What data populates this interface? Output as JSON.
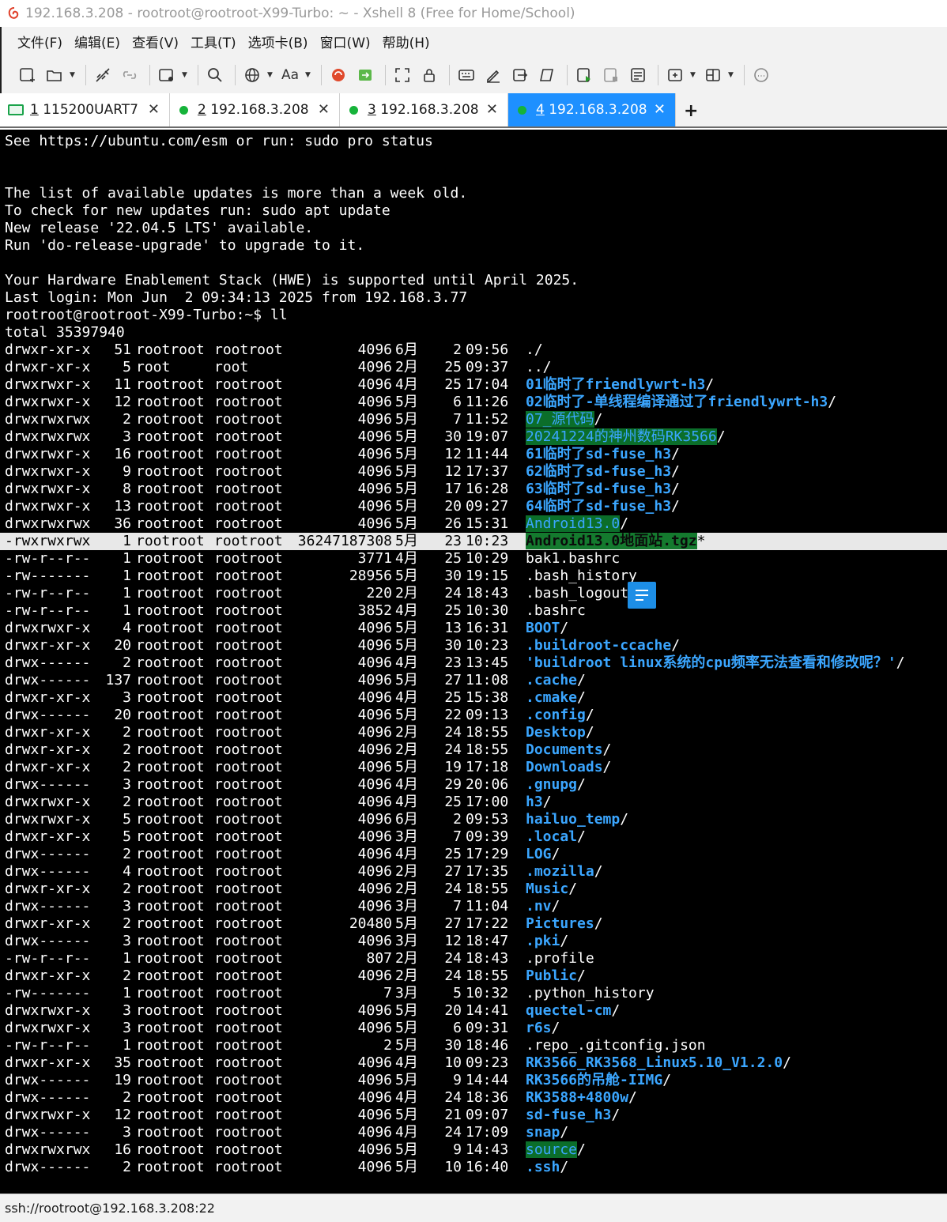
{
  "window": {
    "title": "192.168.3.208 - rootroot@rootroot-X99-Turbo: ~ - Xshell 8 (Free for Home/School)"
  },
  "menu": [
    "文件(F)",
    "编辑(E)",
    "查看(V)",
    "工具(T)",
    "选项卡(B)",
    "窗口(W)",
    "帮助(H)"
  ],
  "toolbar": {
    "font_label": "Aa"
  },
  "tabs": [
    {
      "num": "1",
      "label": " 115200UART7",
      "status": "serial",
      "active": false
    },
    {
      "num": "2",
      "label": " 192.168.3.208",
      "status": "connected",
      "active": false
    },
    {
      "num": "3",
      "label": " 192.168.3.208",
      "status": "connected",
      "active": false
    },
    {
      "num": "4",
      "label": " 192.168.3.208",
      "status": "connected",
      "active": true
    }
  ],
  "new_tab_label": "+",
  "terminal": {
    "header_lines": [
      "See https://ubuntu.com/esm or run: sudo pro status",
      "",
      "",
      "The list of available updates is more than a week old.",
      "To check for new updates run: sudo apt update",
      "New release '22.04.5 LTS' available.",
      "Run 'do-release-upgrade' to upgrade to it.",
      "",
      "Your Hardware Enablement Stack (HWE) is supported until April 2025.",
      "Last login: Mon Jun  2 09:34:13 2025 from 192.168.3.77",
      "rootroot@rootroot-X99-Turbo:~$ ll",
      "total 35397940"
    ],
    "entries": [
      {
        "perm": "drwxr-xr-x",
        "links": "51",
        "owner": "rootroot",
        "group": "rootroot",
        "size": "4096",
        "month": "6月",
        "day": "2",
        "time": "09:56",
        "name": "./",
        "style": "plain",
        "suffix": ""
      },
      {
        "perm": "drwxr-xr-x",
        "links": "5",
        "owner": "root",
        "group": "root",
        "size": "4096",
        "month": "2月",
        "day": "25",
        "time": "09:37",
        "name": "../",
        "style": "plain",
        "suffix": ""
      },
      {
        "perm": "drwxrwxr-x",
        "links": "11",
        "owner": "rootroot",
        "group": "rootroot",
        "size": "4096",
        "month": "4月",
        "day": "25",
        "time": "17:04",
        "name": "01临时了friendlywrt-h3",
        "style": "dir",
        "suffix": "/"
      },
      {
        "perm": "drwxrwxr-x",
        "links": "12",
        "owner": "rootroot",
        "group": "rootroot",
        "size": "4096",
        "month": "5月",
        "day": "6",
        "time": "11:26",
        "name": "02临时了-单线程编译通过了friendlywrt-h3",
        "style": "dir",
        "suffix": "/"
      },
      {
        "perm": "drwxrwxrwx",
        "links": "2",
        "owner": "rootroot",
        "group": "rootroot",
        "size": "4096",
        "month": "5月",
        "day": "7",
        "time": "11:52",
        "name": "07_源代码",
        "style": "hl",
        "suffix": "/"
      },
      {
        "perm": "drwxrwxrwx",
        "links": "3",
        "owner": "rootroot",
        "group": "rootroot",
        "size": "4096",
        "month": "5月",
        "day": "30",
        "time": "19:07",
        "name": "20241224的神州数码RK3566",
        "style": "hl",
        "suffix": "/"
      },
      {
        "perm": "drwxrwxr-x",
        "links": "16",
        "owner": "rootroot",
        "group": "rootroot",
        "size": "4096",
        "month": "5月",
        "day": "12",
        "time": "11:44",
        "name": "61临时了sd-fuse_h3",
        "style": "dir",
        "suffix": "/"
      },
      {
        "perm": "drwxrwxr-x",
        "links": "9",
        "owner": "rootroot",
        "group": "rootroot",
        "size": "4096",
        "month": "5月",
        "day": "12",
        "time": "17:37",
        "name": "62临时了sd-fuse_h3",
        "style": "dir",
        "suffix": "/"
      },
      {
        "perm": "drwxrwxr-x",
        "links": "8",
        "owner": "rootroot",
        "group": "rootroot",
        "size": "4096",
        "month": "5月",
        "day": "17",
        "time": "16:28",
        "name": "63临时了sd-fuse_h3",
        "style": "dir",
        "suffix": "/"
      },
      {
        "perm": "drwxrwxr-x",
        "links": "13",
        "owner": "rootroot",
        "group": "rootroot",
        "size": "4096",
        "month": "5月",
        "day": "20",
        "time": "09:27",
        "name": "64临时了sd-fuse_h3",
        "style": "dir",
        "suffix": "/"
      },
      {
        "perm": "drwxrwxrwx",
        "links": "36",
        "owner": "rootroot",
        "group": "rootroot",
        "size": "4096",
        "month": "5月",
        "day": "26",
        "time": "15:31",
        "name": "Android13.0",
        "style": "hl",
        "suffix": "/"
      },
      {
        "perm": "-rwxrwxrwx",
        "links": "1",
        "owner": "rootroot",
        "group": "rootroot",
        "size": "36247187308",
        "month": "5月",
        "day": "23",
        "time": "10:23",
        "name": "Android13.0地面站.tgz",
        "style": "exec",
        "suffix": "*"
      },
      {
        "perm": "-rw-r--r--",
        "links": "1",
        "owner": "rootroot",
        "group": "rootroot",
        "size": "3771",
        "month": "4月",
        "day": "25",
        "time": "10:29",
        "name": "bak1.bashrc",
        "style": "plain",
        "suffix": ""
      },
      {
        "perm": "-rw-------",
        "links": "1",
        "owner": "rootroot",
        "group": "rootroot",
        "size": "28956",
        "month": "5月",
        "day": "30",
        "time": "19:15",
        "name": ".bash_history",
        "style": "plain",
        "suffix": ""
      },
      {
        "perm": "-rw-r--r--",
        "links": "1",
        "owner": "rootroot",
        "group": "rootroot",
        "size": "220",
        "month": "2月",
        "day": "24",
        "time": "18:43",
        "name": ".bash_logout",
        "style": "plain",
        "suffix": ""
      },
      {
        "perm": "-rw-r--r--",
        "links": "1",
        "owner": "rootroot",
        "group": "rootroot",
        "size": "3852",
        "month": "4月",
        "day": "25",
        "time": "10:30",
        "name": ".bashrc",
        "style": "plain",
        "suffix": ""
      },
      {
        "perm": "drwxrwxr-x",
        "links": "4",
        "owner": "rootroot",
        "group": "rootroot",
        "size": "4096",
        "month": "5月",
        "day": "13",
        "time": "16:31",
        "name": "BOOT",
        "style": "dir",
        "suffix": "/"
      },
      {
        "perm": "drwxr-xr-x",
        "links": "20",
        "owner": "rootroot",
        "group": "rootroot",
        "size": "4096",
        "month": "5月",
        "day": "30",
        "time": "10:23",
        "name": ".buildroot-ccache",
        "style": "dir",
        "suffix": "/"
      },
      {
        "perm": "drwx------",
        "links": "2",
        "owner": "rootroot",
        "group": "rootroot",
        "size": "4096",
        "month": "4月",
        "day": "23",
        "time": "13:45",
        "name": "'buildroot linux系统的cpu频率无法查看和修改呢？'",
        "style": "dir",
        "suffix": "/"
      },
      {
        "perm": "drwx------",
        "links": "137",
        "owner": "rootroot",
        "group": "rootroot",
        "size": "4096",
        "month": "5月",
        "day": "27",
        "time": "11:08",
        "name": ".cache",
        "style": "dir",
        "suffix": "/"
      },
      {
        "perm": "drwxr-xr-x",
        "links": "3",
        "owner": "rootroot",
        "group": "rootroot",
        "size": "4096",
        "month": "4月",
        "day": "25",
        "time": "15:38",
        "name": ".cmake",
        "style": "dir",
        "suffix": "/"
      },
      {
        "perm": "drwx------",
        "links": "20",
        "owner": "rootroot",
        "group": "rootroot",
        "size": "4096",
        "month": "5月",
        "day": "22",
        "time": "09:13",
        "name": ".config",
        "style": "dir",
        "suffix": "/"
      },
      {
        "perm": "drwxr-xr-x",
        "links": "2",
        "owner": "rootroot",
        "group": "rootroot",
        "size": "4096",
        "month": "2月",
        "day": "24",
        "time": "18:55",
        "name": "Desktop",
        "style": "dir",
        "suffix": "/"
      },
      {
        "perm": "drwxr-xr-x",
        "links": "2",
        "owner": "rootroot",
        "group": "rootroot",
        "size": "4096",
        "month": "2月",
        "day": "24",
        "time": "18:55",
        "name": "Documents",
        "style": "dir",
        "suffix": "/"
      },
      {
        "perm": "drwxr-xr-x",
        "links": "2",
        "owner": "rootroot",
        "group": "rootroot",
        "size": "4096",
        "month": "5月",
        "day": "19",
        "time": "17:18",
        "name": "Downloads",
        "style": "dir",
        "suffix": "/"
      },
      {
        "perm": "drwx------",
        "links": "3",
        "owner": "rootroot",
        "group": "rootroot",
        "size": "4096",
        "month": "4月",
        "day": "29",
        "time": "20:06",
        "name": ".gnupg",
        "style": "dir",
        "suffix": "/"
      },
      {
        "perm": "drwxrwxr-x",
        "links": "2",
        "owner": "rootroot",
        "group": "rootroot",
        "size": "4096",
        "month": "4月",
        "day": "25",
        "time": "17:00",
        "name": "h3",
        "style": "dir",
        "suffix": "/"
      },
      {
        "perm": "drwxrwxr-x",
        "links": "5",
        "owner": "rootroot",
        "group": "rootroot",
        "size": "4096",
        "month": "6月",
        "day": "2",
        "time": "09:53",
        "name": "hailuo_temp",
        "style": "dir",
        "suffix": "/"
      },
      {
        "perm": "drwxr-xr-x",
        "links": "5",
        "owner": "rootroot",
        "group": "rootroot",
        "size": "4096",
        "month": "3月",
        "day": "7",
        "time": "09:39",
        "name": ".local",
        "style": "dir",
        "suffix": "/"
      },
      {
        "perm": "drwx------",
        "links": "2",
        "owner": "rootroot",
        "group": "rootroot",
        "size": "4096",
        "month": "4月",
        "day": "25",
        "time": "17:29",
        "name": "LOG",
        "style": "dir",
        "suffix": "/"
      },
      {
        "perm": "drwx------",
        "links": "4",
        "owner": "rootroot",
        "group": "rootroot",
        "size": "4096",
        "month": "2月",
        "day": "27",
        "time": "17:35",
        "name": ".mozilla",
        "style": "dir",
        "suffix": "/"
      },
      {
        "perm": "drwxr-xr-x",
        "links": "2",
        "owner": "rootroot",
        "group": "rootroot",
        "size": "4096",
        "month": "2月",
        "day": "24",
        "time": "18:55",
        "name": "Music",
        "style": "dir",
        "suffix": "/"
      },
      {
        "perm": "drwx------",
        "links": "3",
        "owner": "rootroot",
        "group": "rootroot",
        "size": "4096",
        "month": "3月",
        "day": "7",
        "time": "11:04",
        "name": ".nv",
        "style": "dir",
        "suffix": "/"
      },
      {
        "perm": "drwxr-xr-x",
        "links": "2",
        "owner": "rootroot",
        "group": "rootroot",
        "size": "20480",
        "month": "5月",
        "day": "27",
        "time": "17:22",
        "name": "Pictures",
        "style": "dir",
        "suffix": "/"
      },
      {
        "perm": "drwx------",
        "links": "3",
        "owner": "rootroot",
        "group": "rootroot",
        "size": "4096",
        "month": "3月",
        "day": "12",
        "time": "18:47",
        "name": ".pki",
        "style": "dir",
        "suffix": "/"
      },
      {
        "perm": "-rw-r--r--",
        "links": "1",
        "owner": "rootroot",
        "group": "rootroot",
        "size": "807",
        "month": "2月",
        "day": "24",
        "time": "18:43",
        "name": ".profile",
        "style": "plain",
        "suffix": ""
      },
      {
        "perm": "drwxr-xr-x",
        "links": "2",
        "owner": "rootroot",
        "group": "rootroot",
        "size": "4096",
        "month": "2月",
        "day": "24",
        "time": "18:55",
        "name": "Public",
        "style": "dir",
        "suffix": "/"
      },
      {
        "perm": "-rw-------",
        "links": "1",
        "owner": "rootroot",
        "group": "rootroot",
        "size": "7",
        "month": "3月",
        "day": "5",
        "time": "10:32",
        "name": ".python_history",
        "style": "plain",
        "suffix": ""
      },
      {
        "perm": "drwxrwxr-x",
        "links": "3",
        "owner": "rootroot",
        "group": "rootroot",
        "size": "4096",
        "month": "5月",
        "day": "20",
        "time": "14:41",
        "name": "quectel-cm",
        "style": "dir",
        "suffix": "/"
      },
      {
        "perm": "drwxrwxr-x",
        "links": "3",
        "owner": "rootroot",
        "group": "rootroot",
        "size": "4096",
        "month": "5月",
        "day": "6",
        "time": "09:31",
        "name": "r6s",
        "style": "dir",
        "suffix": "/"
      },
      {
        "perm": "-rw-r--r--",
        "links": "1",
        "owner": "rootroot",
        "group": "rootroot",
        "size": "2",
        "month": "5月",
        "day": "30",
        "time": "18:46",
        "name": ".repo_.gitconfig.json",
        "style": "plain",
        "suffix": ""
      },
      {
        "perm": "drwxr-xr-x",
        "links": "35",
        "owner": "rootroot",
        "group": "rootroot",
        "size": "4096",
        "month": "4月",
        "day": "10",
        "time": "09:23",
        "name": "RK3566_RK3568_Linux5.10_V1.2.0",
        "style": "dir",
        "suffix": "/"
      },
      {
        "perm": "drwx------",
        "links": "19",
        "owner": "rootroot",
        "group": "rootroot",
        "size": "4096",
        "month": "5月",
        "day": "9",
        "time": "14:44",
        "name": "RK3566的吊舱-IIMG",
        "style": "dir",
        "suffix": "/"
      },
      {
        "perm": "drwx------",
        "links": "2",
        "owner": "rootroot",
        "group": "rootroot",
        "size": "4096",
        "month": "4月",
        "day": "24",
        "time": "18:36",
        "name": "RK3588+4800w",
        "style": "dir",
        "suffix": "/"
      },
      {
        "perm": "drwxrwxr-x",
        "links": "12",
        "owner": "rootroot",
        "group": "rootroot",
        "size": "4096",
        "month": "5月",
        "day": "21",
        "time": "09:07",
        "name": "sd-fuse_h3",
        "style": "dir",
        "suffix": "/"
      },
      {
        "perm": "drwx------",
        "links": "3",
        "owner": "rootroot",
        "group": "rootroot",
        "size": "4096",
        "month": "4月",
        "day": "24",
        "time": "17:09",
        "name": "snap",
        "style": "dir",
        "suffix": "/"
      },
      {
        "perm": "drwxrwxrwx",
        "links": "16",
        "owner": "rootroot",
        "group": "rootroot",
        "size": "4096",
        "month": "5月",
        "day": "9",
        "time": "14:43",
        "name": "source",
        "style": "hl",
        "suffix": "/"
      },
      {
        "perm": "drwx------",
        "links": "2",
        "owner": "rootroot",
        "group": "rootroot",
        "size": "4096",
        "month": "5月",
        "day": "10",
        "time": "16:40",
        "name": ".ssh",
        "style": "dir",
        "suffix": "/"
      }
    ]
  },
  "status": {
    "connection": "ssh://rootroot@192.168.3.208:22"
  },
  "colors": {
    "terminal_bg": "#000000",
    "dir_blue": "#3ba6ff",
    "highlight_green": "#0b6e2a",
    "active_tab": "#1e90ff",
    "status_dot": "#16b33a"
  }
}
